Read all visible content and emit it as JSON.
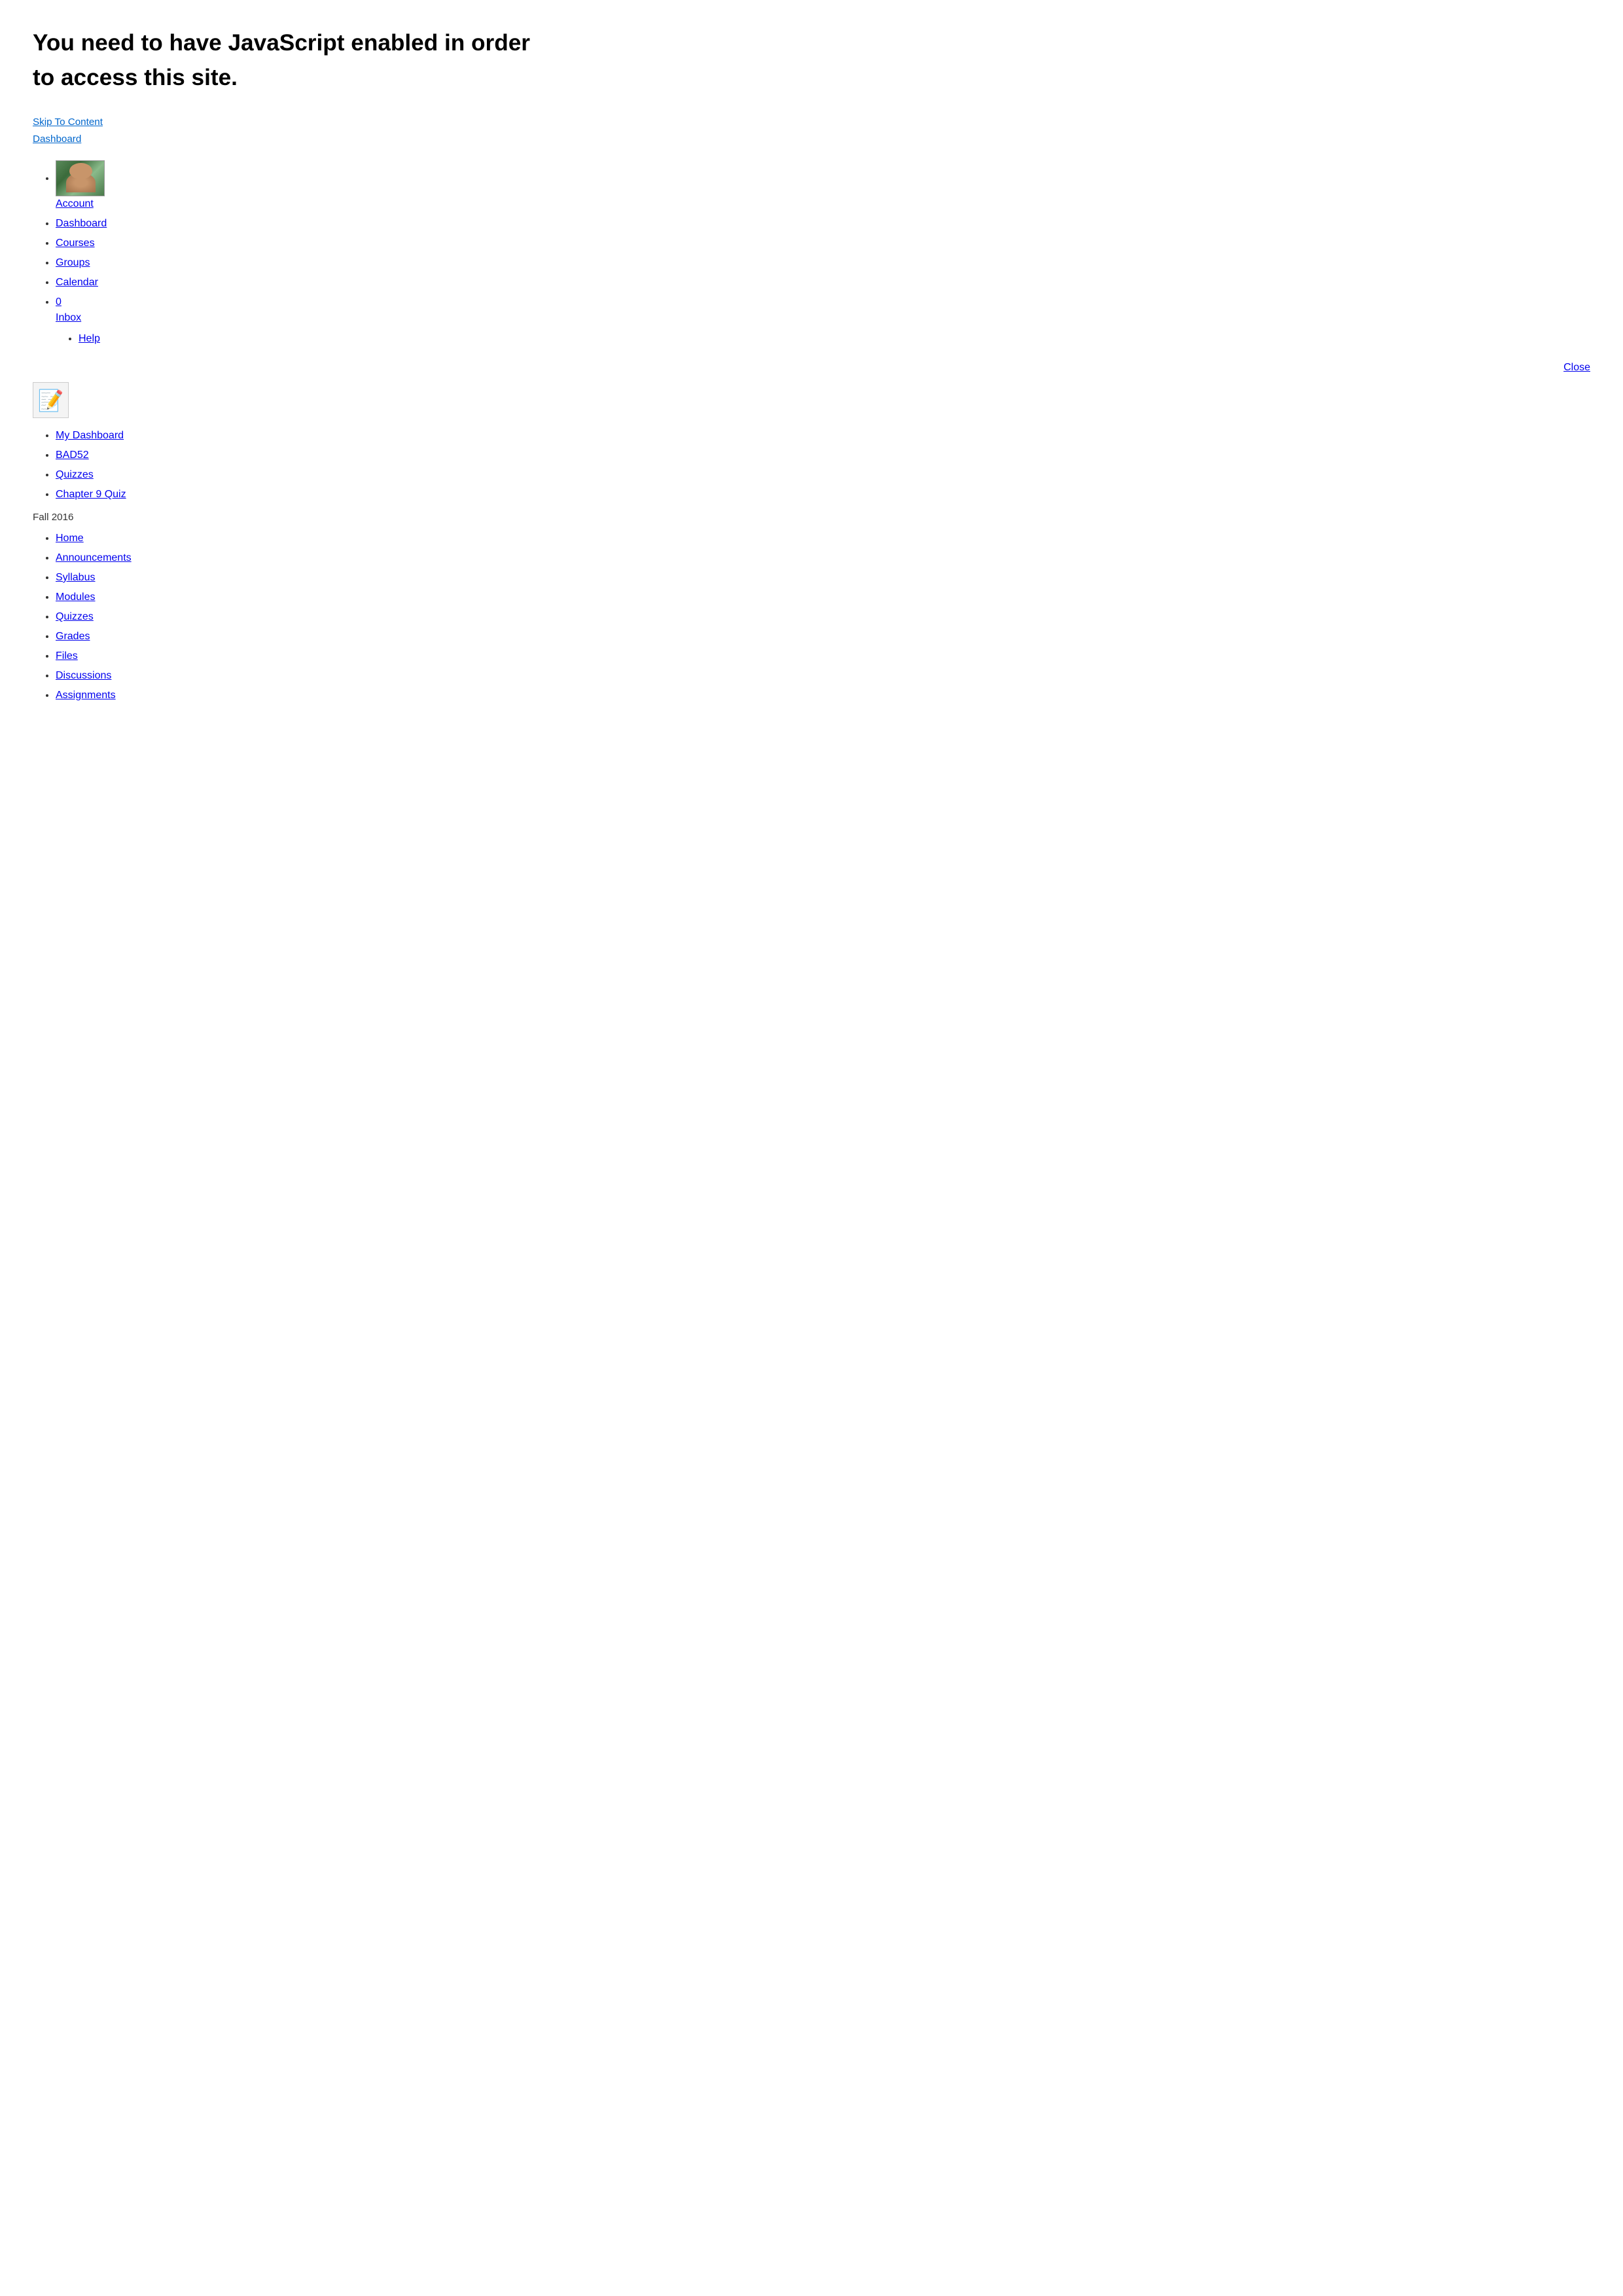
{
  "page": {
    "js_warning": "You need to have JavaScript enabled in order to access this site.",
    "skip_to_content_label": "Skip To Content",
    "dashboard_top_label": "Dashboard",
    "close_label": "Close"
  },
  "top_nav": {
    "account_label": "Account",
    "dashboard_label": "Dashboard",
    "courses_label": "Courses",
    "groups_label": "Groups",
    "calendar_label": "Calendar",
    "inbox_count": "0",
    "inbox_label": "Inbox",
    "help_label": "Help"
  },
  "breadcrumb": {
    "items": [
      {
        "label": "My Dashboard",
        "href": "#"
      },
      {
        "label": "BAD52",
        "href": "#"
      },
      {
        "label": "Quizzes",
        "href": "#"
      },
      {
        "label": "Chapter 9 Quiz",
        "href": "#"
      }
    ]
  },
  "course": {
    "semester_label": "Fall 2016",
    "nav_items": [
      {
        "label": "Home"
      },
      {
        "label": "Announcements"
      },
      {
        "label": "Syllabus"
      },
      {
        "label": "Modules"
      },
      {
        "label": "Quizzes"
      },
      {
        "label": "Grades"
      },
      {
        "label": "Files"
      },
      {
        "label": "Discussions"
      },
      {
        "label": "Assignments"
      }
    ]
  }
}
